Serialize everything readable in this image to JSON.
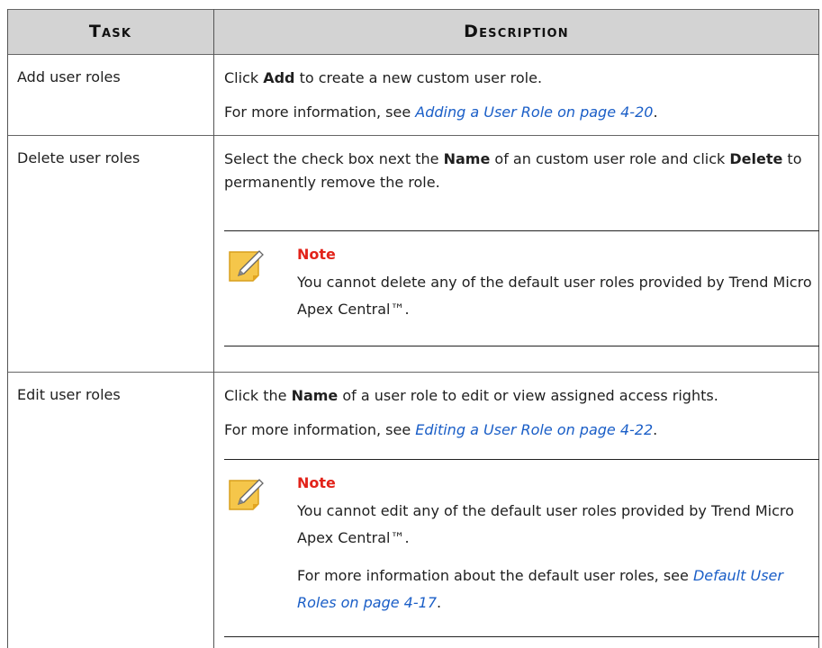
{
  "header": {
    "task": "Task",
    "description": "Description"
  },
  "rows": [
    {
      "task": "Add user roles",
      "desc1": {
        "pre": "Click ",
        "bold": "Add",
        "post": " to create a new custom user role."
      },
      "desc2": {
        "pre": "For more information, see ",
        "link": "Adding a User Role on page 4-20",
        "post": "."
      }
    },
    {
      "task": "Delete user roles",
      "desc1": {
        "pre": "Select the check box next the ",
        "bold": "Name",
        "mid": " of an custom user role and click ",
        "bold2": "Delete",
        "post": " to permanently remove the role."
      },
      "note": {
        "title": "Note",
        "text": "You cannot delete any of the default user roles provided by Trend Micro Apex Central™."
      }
    },
    {
      "task": "Edit user roles",
      "desc1": {
        "pre": "Click the ",
        "bold": "Name",
        "post": " of a user role to edit or view assigned access rights."
      },
      "desc2": {
        "pre": "For more information, see ",
        "link": "Editing a User Role on page 4-22",
        "post": "."
      },
      "note": {
        "title": "Note",
        "text": "You cannot edit any of the default user roles provided by Trend Micro Apex Central™.",
        "text2_pre": "For more information about the default user roles, see ",
        "text2_link": "Default User Roles on page 4-17",
        "text2_post": "."
      }
    }
  ],
  "colors": {
    "header_bg": "#d3d3d3",
    "link": "#1a5ec7",
    "note_title": "#e2231a",
    "note_icon": "#f5c64a"
  },
  "icons": {
    "note": "note-pencil-icon"
  }
}
